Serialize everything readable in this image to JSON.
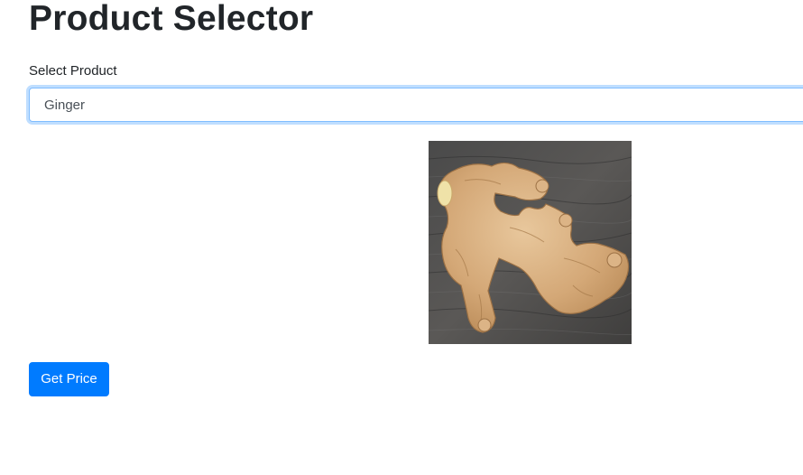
{
  "page": {
    "title": "Product Selector"
  },
  "form": {
    "select_label": "Select Product",
    "selected_product": "Ginger",
    "submit_label": "Get Price"
  },
  "image": {
    "subject": "ginger-root"
  },
  "colors": {
    "primary": "#007bff",
    "focus_border": "#80bdff",
    "text": "#212529",
    "input_text": "#495057"
  }
}
